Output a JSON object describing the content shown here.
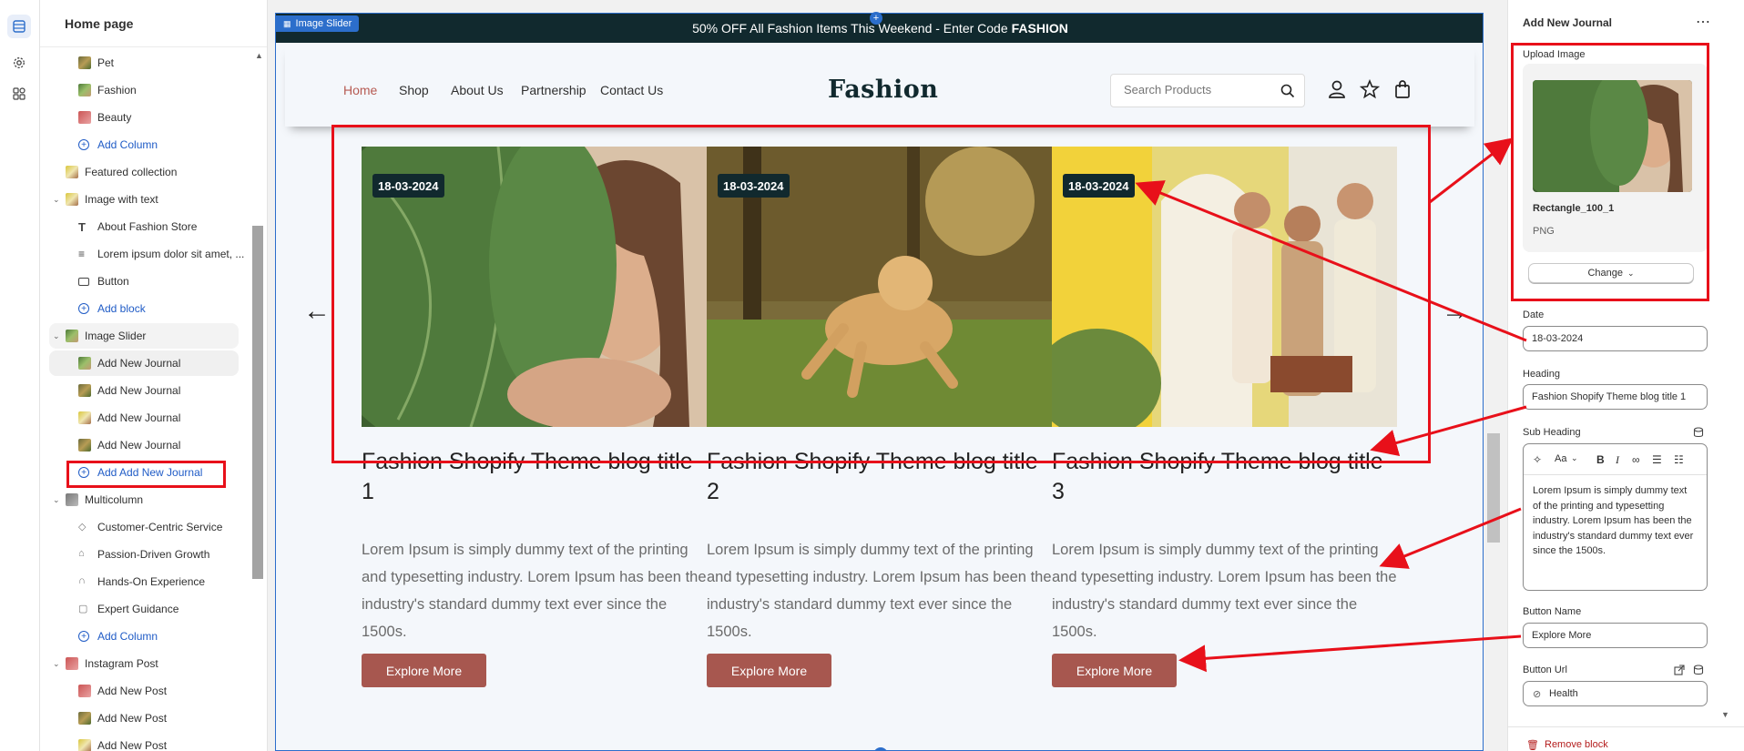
{
  "sidebar": {
    "header": "Home page",
    "items": [
      {
        "label": "Pet",
        "thumb": "thumb-dog"
      },
      {
        "label": "Fashion",
        "thumb": "thumb-leaf"
      },
      {
        "label": "Beauty",
        "thumb": "thumb-pink"
      },
      {
        "label": "Add Column"
      },
      {
        "label": "Featured collection"
      },
      {
        "label": "Image with text"
      },
      {
        "label": "About Fashion Store"
      },
      {
        "label": "Lorem ipsum dolor sit amet, ..."
      },
      {
        "label": "Button"
      },
      {
        "label": "Add block"
      },
      {
        "label": "Image Slider"
      },
      {
        "label": "Add New Journal"
      },
      {
        "label": "Add New Journal"
      },
      {
        "label": "Add New Journal"
      },
      {
        "label": "Add New Journal"
      },
      {
        "label": "Add Add New Journal"
      },
      {
        "label": "Multicolumn"
      },
      {
        "label": "Customer-Centric Service"
      },
      {
        "label": "Passion-Driven Growth"
      },
      {
        "label": "Hands-On Experience"
      },
      {
        "label": "Expert Guidance"
      },
      {
        "label": "Add Column"
      },
      {
        "label": "Instagram Post"
      },
      {
        "label": "Add New Post"
      },
      {
        "label": "Add New Post"
      },
      {
        "label": "Add New Post"
      }
    ]
  },
  "preview": {
    "section_tag": "Image Slider",
    "announcement": "50% OFF All Fashion Items This Weekend - Enter Code",
    "announcement_code": "FASHION",
    "nav": [
      "Home",
      "Shop",
      "About Us",
      "Partnership",
      "Contact Us"
    ],
    "logo": "Fashion",
    "search_placeholder": "Search Products",
    "prev_arrow": "←",
    "next_arrow": "→",
    "cards": [
      {
        "date": "18-03-2024",
        "title": "Fashion Shopify Theme blog title 1",
        "desc": "Lorem Ipsum is simply dummy text of the printing and typesetting industry. Lorem Ipsum has been the industry's standard dummy text ever since the 1500s.",
        "button": "Explore More"
      },
      {
        "date": "18-03-2024",
        "title": "Fashion Shopify Theme blog title 2",
        "desc": "Lorem Ipsum is simply dummy text of the printing and typesetting industry. Lorem Ipsum has been the industry's standard dummy text ever since the 1500s.",
        "button": "Explore More"
      },
      {
        "date": "18-03-2024",
        "title": "Fashion Shopify Theme blog title 3",
        "desc": "Lorem Ipsum is simply dummy text of the printing and typesetting industry. Lorem Ipsum has been the industry's standard dummy text ever since the 1500s.",
        "button": "Explore More"
      }
    ]
  },
  "inspector": {
    "title": "Add New Journal",
    "more": "⋯",
    "upload_label": "Upload Image",
    "file_name": "Rectangle_100_1",
    "file_type": "PNG",
    "change_label": "Change",
    "date_label": "Date",
    "date_value": "18-03-2024",
    "heading_label": "Heading",
    "heading_value": "Fashion Shopify Theme blog title 1",
    "subheading_label": "Sub Heading",
    "subheading_text": "Lorem Ipsum is simply dummy text of the printing and typesetting industry. Lorem Ipsum has been the industry's standard dummy text ever since the 1500s.",
    "button_name_label": "Button Name",
    "button_name_value": "Explore More",
    "button_url_label": "Button Url",
    "button_url_value": "Health",
    "remove_label": "Remove block"
  },
  "colors": {
    "accent": "#2c6ecb",
    "brand_dark": "#11292e",
    "button": "#a7574f",
    "annotation": "#e8101a"
  }
}
